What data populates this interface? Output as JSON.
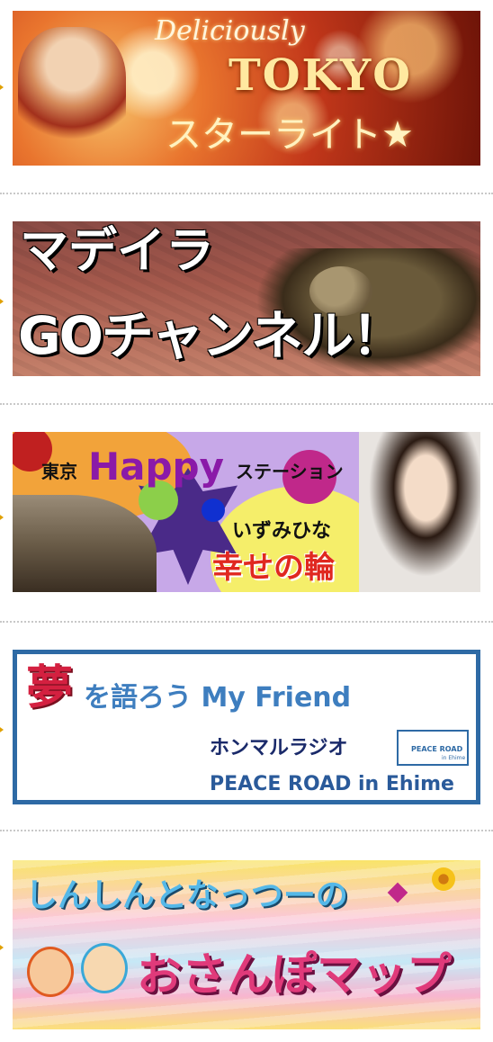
{
  "banners": [
    {
      "id": "tokyo-starlight",
      "line1": "Deliciously",
      "line2": "TOKYO",
      "line3": "スターライト★"
    },
    {
      "id": "madeira-go",
      "line1": "マデイラ",
      "line2": "GOチャンネル！"
    },
    {
      "id": "tokyo-happy-station",
      "tag": "東京",
      "happy": "Happy",
      "station": "ステーション",
      "host": "いずみひな",
      "subtitle": "幸せの輪"
    },
    {
      "id": "yume-wo-katarou",
      "yume": "夢",
      "title": "を語ろう My Friend",
      "radio": "ホンマルラジオ",
      "logo_text": "PEACE ROAD",
      "logo_sub": "in Ehime",
      "footer": "PEACE ROAD in Ehime"
    },
    {
      "id": "shinshin-nattsu",
      "line1": "しんしんとなっつーの",
      "line2": "おさんぽマップ"
    }
  ],
  "colors": {
    "bullet": "#e0a000",
    "separator": "#c8c8c8",
    "frame_blue": "#2e6aa5"
  },
  "icons": [
    "bullet-arrow-icon"
  ]
}
